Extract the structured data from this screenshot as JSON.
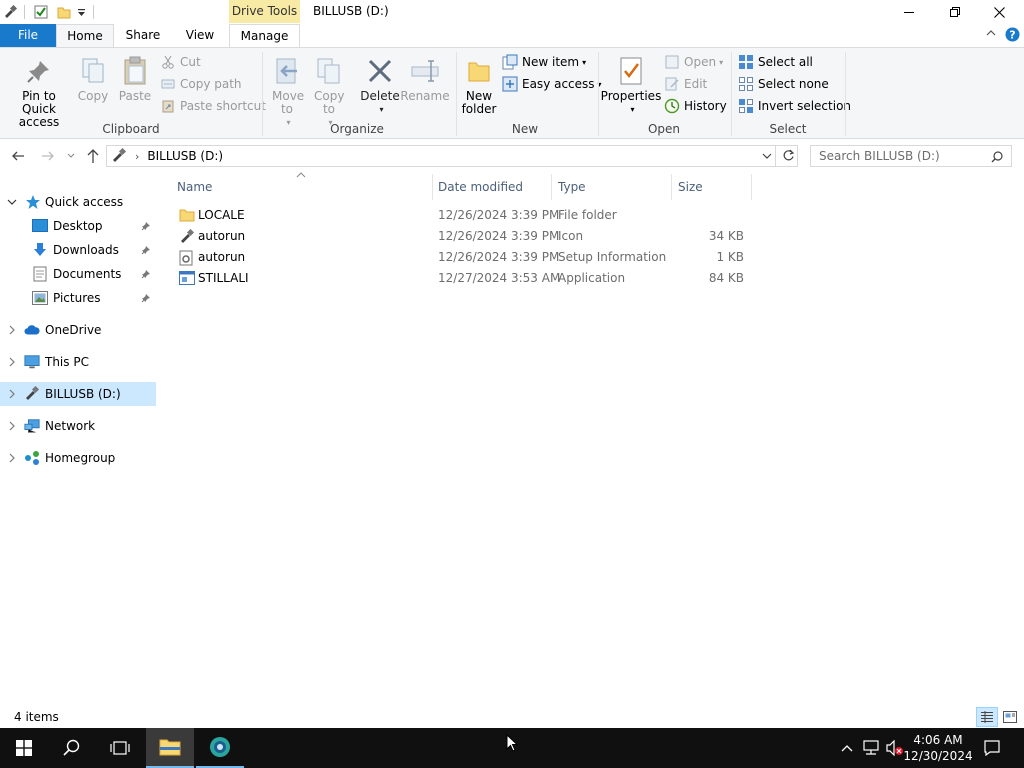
{
  "window": {
    "title": "BILLUSB (D:)",
    "context_tab_group": "Drive Tools"
  },
  "tabs": {
    "file": "File",
    "home": "Home",
    "share": "Share",
    "view": "View",
    "manage": "Manage"
  },
  "ribbon": {
    "clipboard": {
      "label": "Clipboard",
      "pin": "Pin to Quick access",
      "copy": "Copy",
      "paste": "Paste",
      "cut": "Cut",
      "copy_path": "Copy path",
      "paste_shortcut": "Paste shortcut"
    },
    "organize": {
      "label": "Organize",
      "move_to": "Move to",
      "copy_to": "Copy to",
      "delete": "Delete",
      "rename": "Rename"
    },
    "new": {
      "label": "New",
      "new_folder": "New folder",
      "new_item": "New item",
      "easy_access": "Easy access"
    },
    "open": {
      "label": "Open",
      "properties": "Properties",
      "open": "Open",
      "edit": "Edit",
      "history": "History"
    },
    "select": {
      "label": "Select",
      "select_all": "Select all",
      "select_none": "Select none",
      "invert": "Invert selection"
    }
  },
  "address": {
    "path": "BILLUSB (D:)",
    "search_placeholder": "Search BILLUSB (D:)"
  },
  "sidebar": {
    "quick_access": "Quick access",
    "desktop": "Desktop",
    "downloads": "Downloads",
    "documents": "Documents",
    "pictures": "Pictures",
    "onedrive": "OneDrive",
    "this_pc": "This PC",
    "billusb": "BILLUSB (D:)",
    "network": "Network",
    "homegroup": "Homegroup"
  },
  "columns": {
    "name": "Name",
    "date": "Date modified",
    "type": "Type",
    "size": "Size"
  },
  "files": [
    {
      "name": "LOCALE",
      "date": "12/26/2024 3:39 PM",
      "type": "File folder",
      "size": ""
    },
    {
      "name": "autorun",
      "date": "12/26/2024 3:39 PM",
      "type": "Icon",
      "size": "34 KB"
    },
    {
      "name": "autorun",
      "date": "12/26/2024 3:39 PM",
      "type": "Setup Information",
      "size": "1 KB"
    },
    {
      "name": "STILLALI",
      "date": "12/27/2024 3:53 AM",
      "type": "Application",
      "size": "84 KB"
    }
  ],
  "status": {
    "items": "4 items"
  },
  "taskbar": {
    "time": "4:06 AM",
    "date": "12/30/2024"
  },
  "colors": {
    "accent": "#1979ca",
    "selection": "#cce8ff",
    "context_tab": "#f7eaa4",
    "taskbar": "#101010"
  }
}
